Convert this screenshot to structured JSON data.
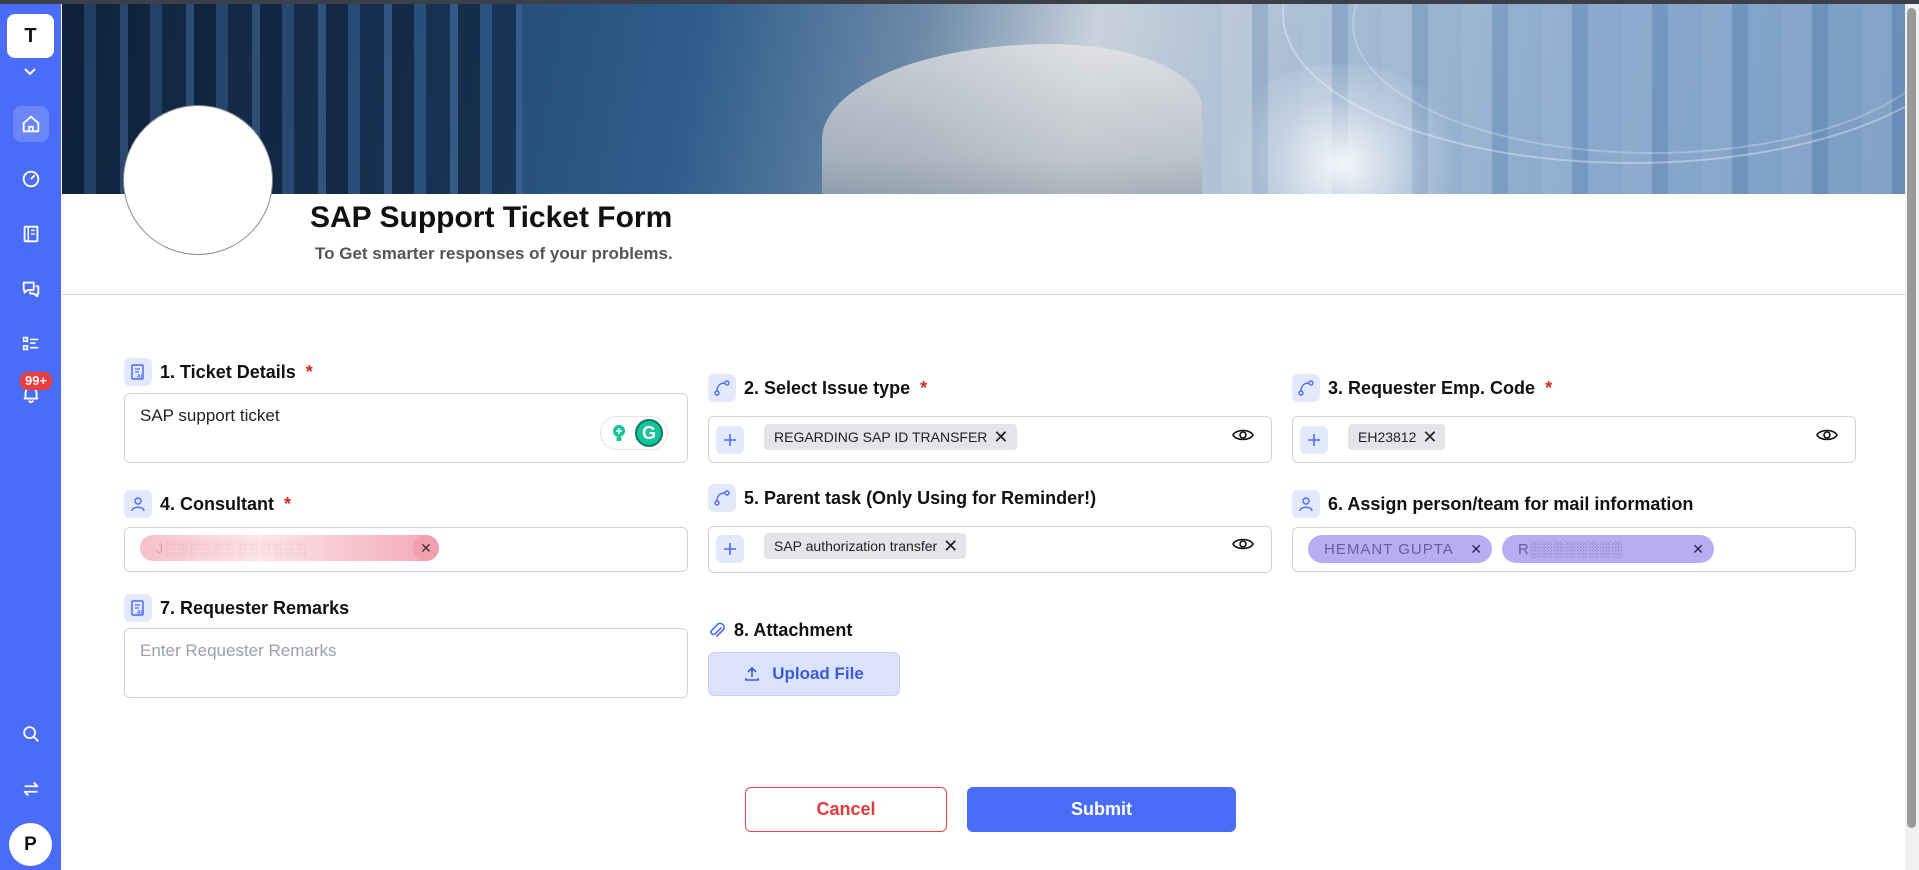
{
  "sidebar": {
    "workspace_initial": "T",
    "notification_badge": "99+",
    "user_initial": "P"
  },
  "form": {
    "title": "SAP Support Ticket Form",
    "subtitle": "To Get smarter responses of your problems.",
    "required_marker": "*",
    "fields": {
      "ticket_details": {
        "label": "1. Ticket Details",
        "value": "SAP support ticket"
      },
      "issue_type": {
        "label": "2. Select Issue type",
        "chip": "REGARDING SAP ID TRANSFER"
      },
      "requester_emp_code": {
        "label": "3. Requester Emp. Code",
        "chip": "EH23812"
      },
      "consultant": {
        "label": "4. Consultant",
        "chip": "J░░░░░░░░░░░░"
      },
      "parent_task": {
        "label": "5. Parent task (Only Using for Reminder!)",
        "chip": "SAP authorization transfer"
      },
      "assign_person": {
        "label": "6. Assign person/team for mail information",
        "chips": [
          "HEMANT GUPTA",
          "R░░░░░░░░"
        ]
      },
      "requester_remarks": {
        "label": "7. Requester Remarks",
        "placeholder": "Enter Requester Remarks"
      },
      "attachment": {
        "label": "8. Attachment",
        "button": "Upload File"
      }
    }
  },
  "actions": {
    "cancel": "Cancel",
    "submit": "Submit"
  },
  "colors": {
    "primary": "#4a6cf7",
    "danger": "#e03b3b",
    "required": "#e02424"
  }
}
